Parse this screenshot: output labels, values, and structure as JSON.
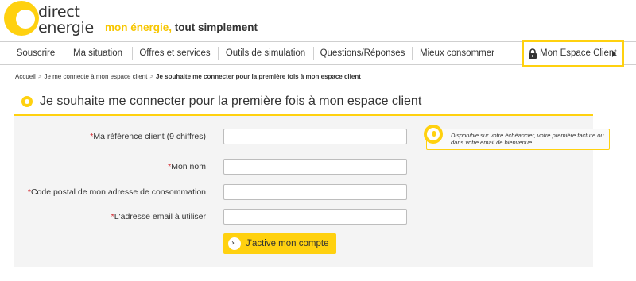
{
  "brand": {
    "line1": "direct",
    "line2": "energie",
    "tagline_accent": "mon énergie,",
    "tagline_rest": " tout simplement",
    "accent_color": "#ffd10f"
  },
  "nav": {
    "items": [
      {
        "label": "Souscrire"
      },
      {
        "label": "Ma situation"
      },
      {
        "label": "Offres et services"
      },
      {
        "label": "Outils de simulation"
      },
      {
        "label": "Questions/Réponses"
      },
      {
        "label": "Mieux consommer"
      }
    ],
    "espace_client": {
      "label": "Mon Espace Client",
      "icon": "lock-icon"
    }
  },
  "breadcrumb": {
    "items": [
      "Accueil",
      "Je me connecte à mon espace client"
    ],
    "current": "Je souhaite me connecter pour la première fois à mon espace client",
    "separator": ">"
  },
  "page": {
    "title": "Je souhaite me connecter pour la première fois à mon espace client"
  },
  "form": {
    "required_mark": "*",
    "fields": [
      {
        "label": "Ma référence client (9 chiffres)",
        "value": "",
        "placeholder": ""
      },
      {
        "label": "Mon nom",
        "value": "",
        "placeholder": ""
      },
      {
        "label": "Code postal de mon adresse de consommation",
        "value": "",
        "placeholder": ""
      },
      {
        "label": "L'adresse email à utiliser",
        "value": "",
        "placeholder": ""
      }
    ],
    "tip": "Disponible sur votre échéancier, votre première facture ou dans votre email de bienvenue",
    "submit_label": "J'active mon compte"
  }
}
